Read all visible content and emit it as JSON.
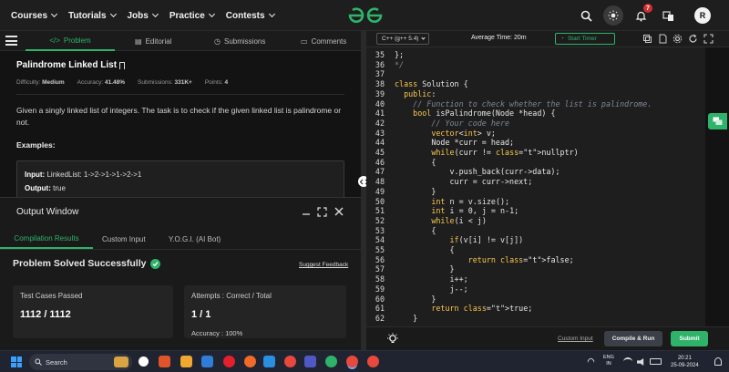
{
  "topnav": {
    "menus": [
      "Courses",
      "Tutorials",
      "Jobs",
      "Practice",
      "Contests"
    ],
    "notification_count": "7",
    "avatar_initial": "R",
    "brand_color": "#2fb36a"
  },
  "left_tabs": {
    "problem": "Problem",
    "editorial": "Editorial",
    "submissions": "Submissions",
    "comments": "Comments"
  },
  "problem": {
    "title": "Palindrome Linked List",
    "difficulty_label": "Difficulty:",
    "difficulty": "Medium",
    "accuracy_label": "Accuracy:",
    "accuracy": "41.48%",
    "submissions_label": "Submissions:",
    "submissions": "331K+",
    "points_label": "Points:",
    "points": "4",
    "description": "Given a singly linked list of integers. The task is to check if the given linked list is palindrome or not.",
    "examples_heading": "Examples:",
    "example_input_label": "Input:",
    "example_input": "LinkedList:  1->2->1->1->2->1",
    "example_output_label": "Output:",
    "example_output": "true"
  },
  "output_window": {
    "title": "Output Window",
    "tabs": [
      "Compilation Results",
      "Custom Input",
      "Y.O.G.I. (AI Bot)"
    ],
    "status": "Problem Solved Successfully",
    "suggest_feedback": "Suggest Feedback",
    "test_cases_label": "Test Cases Passed",
    "test_cases_value": "1112 / 1112",
    "attempts_label": "Attempts : Correct / Total",
    "attempts_value": "1 / 1",
    "accuracy_text": "Accuracy : 100%"
  },
  "editor": {
    "language": "C++ (g++ 5.4)",
    "average_time": "Average Time: 20m",
    "start_timer": "Start Timer",
    "lines": [
      {
        "n": "35",
        "code": "};"
      },
      {
        "n": "36",
        "code": "*/"
      },
      {
        "n": "37",
        "code": ""
      },
      {
        "n": "38",
        "code": "class Solution {"
      },
      {
        "n": "39",
        "code": "  public:"
      },
      {
        "n": "40",
        "code": "    // Function to check whether the list is palindrome."
      },
      {
        "n": "41",
        "code": "    bool isPalindrome(Node *head) {"
      },
      {
        "n": "42",
        "code": "        // Your code here"
      },
      {
        "n": "43",
        "code": "        vector<int> v;"
      },
      {
        "n": "44",
        "code": "        Node *curr = head;"
      },
      {
        "n": "45",
        "code": "        while(curr != nullptr)"
      },
      {
        "n": "46",
        "code": "        {"
      },
      {
        "n": "47",
        "code": "            v.push_back(curr->data);"
      },
      {
        "n": "48",
        "code": "            curr = curr->next;"
      },
      {
        "n": "49",
        "code": "        }"
      },
      {
        "n": "50",
        "code": "        int n = v.size();"
      },
      {
        "n": "51",
        "code": "        int i = 0, j = n-1;"
      },
      {
        "n": "52",
        "code": "        while(i < j)"
      },
      {
        "n": "53",
        "code": "        {"
      },
      {
        "n": "54",
        "code": "            if(v[i] != v[j])"
      },
      {
        "n": "55",
        "code": "            {"
      },
      {
        "n": "56",
        "code": "                return false;"
      },
      {
        "n": "57",
        "code": "            }"
      },
      {
        "n": "58",
        "code": "            i++;"
      },
      {
        "n": "59",
        "code": "            j--;"
      },
      {
        "n": "60",
        "code": "        }"
      },
      {
        "n": "61",
        "code": "        return true;"
      },
      {
        "n": "62",
        "code": "    }"
      }
    ],
    "custom_input": "Custom Input",
    "compile_run": "Compile & Run",
    "submit": "Submit"
  },
  "taskbar": {
    "search_placeholder": "Search",
    "language_line1": "ENG",
    "language_line2": "IN",
    "time": "20:21",
    "date": "25-09-2024"
  }
}
